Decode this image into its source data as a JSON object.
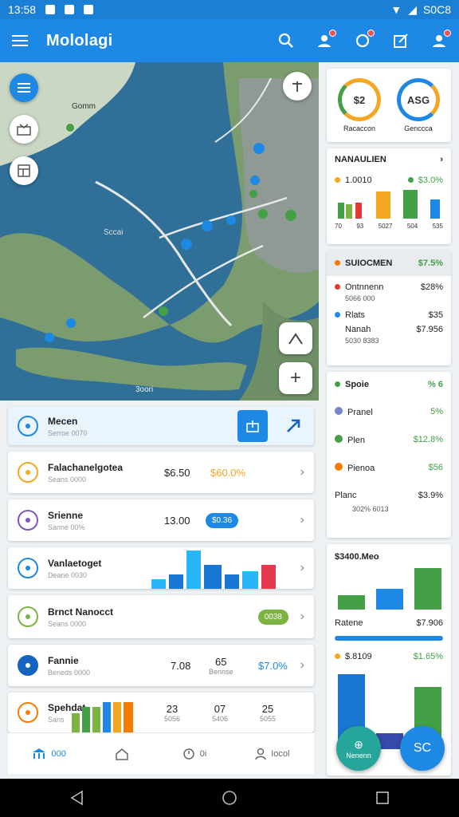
{
  "status_bar": {
    "time": "13:58",
    "right_text": "S0C8"
  },
  "app_bar": {
    "title": "Mololagi"
  },
  "map": {
    "labels": [
      "Gomm",
      "Sccai",
      "3oori"
    ],
    "zoom_in_symbol": "+"
  },
  "list": [
    {
      "title": "Mecen",
      "subtitle": "Serroe 0070",
      "icon_color": "#1e88e5"
    },
    {
      "title": "Falachanelgotea",
      "subtitle": "Seans 0000",
      "value1": "$6.50",
      "value2": "$60.0%",
      "icon_color": "#f5a623"
    },
    {
      "title": "Srienne",
      "subtitle": "Sanne 00%",
      "value1": "13.00",
      "pill": "$0.36",
      "icon_color": "#7e57c2"
    },
    {
      "title": "Vanlaetoget",
      "subtitle": "Deane 0030",
      "icon_color": "#1e88e5"
    },
    {
      "title": "Brnct Nanocct",
      "subtitle": "Seans 0000",
      "pill": "0038",
      "icon_color": "#7cb342"
    },
    {
      "title": "Fannie",
      "subtitle": "Beneds 0000",
      "value1": "7.08",
      "value2": "65",
      "value2_sub": "Bennse",
      "value3": "$7.0%",
      "icon_color": "#1565c0"
    },
    {
      "title": "Spehdat",
      "subtitle": "Sans",
      "value1": "23",
      "value1_sub": "5056",
      "value2": "07",
      "value2_sub": "5406",
      "value3": "25",
      "value3_sub": "5055",
      "icon_color": "#f57c00"
    }
  ],
  "bottom_nav": [
    {
      "label": "000",
      "icon": "bank-icon"
    },
    {
      "label": "",
      "icon": "home-icon"
    },
    {
      "label": "0i",
      "icon": "clock-icon"
    },
    {
      "label": "Iocol",
      "icon": "user-icon"
    }
  ],
  "rings": [
    {
      "value": "$2",
      "label": "Racaccon",
      "color": "#f5a623"
    },
    {
      "value": "ASG",
      "label": "Genccca",
      "color": "#1e88e5"
    }
  ],
  "mini_chart_card": {
    "title": "NANAULIEN",
    "left_legend": "1.0010",
    "right_legend": "$3.0%",
    "axis_labels": [
      "70",
      "93",
      "5027",
      "504",
      "535"
    ]
  },
  "summary_card": {
    "header_label": "SUIOCMEN",
    "header_value": "$7.5%",
    "items": [
      {
        "label": "Ontnnenn",
        "sub": "5066 000",
        "value": "$28%",
        "color": "#e53935"
      },
      {
        "label": "Rlats",
        "sub": "",
        "value": "$35",
        "color": "#1e88e5"
      },
      {
        "label": "Nanah",
        "sub": "5030 8383",
        "value": "$7.956",
        "color": ""
      }
    ]
  },
  "breakdown_card": {
    "header_label": "Spoie",
    "header_value": "% 6",
    "items": [
      {
        "label": "Pranel",
        "value": "5%",
        "color": "#7986cb"
      },
      {
        "label": "Plen",
        "value": "$12.8%",
        "color": "#43a047"
      },
      {
        "label": "Pienoa",
        "value": "$56",
        "color": "#f57c00"
      },
      {
        "label": "Planc",
        "value": "$3.9%",
        "color": ""
      }
    ],
    "footer": "302% 6013"
  },
  "bar_card": {
    "title": "$3400.Meo",
    "mid_label": "Ratene",
    "mid_value": "$7.906",
    "legend_label": "$.8109",
    "legend_value": "$1.65%"
  },
  "fabs": [
    {
      "label": "Nenenn",
      "color": "#26a69a"
    },
    {
      "label": "SC",
      "color": "#1e88e5"
    }
  ]
}
